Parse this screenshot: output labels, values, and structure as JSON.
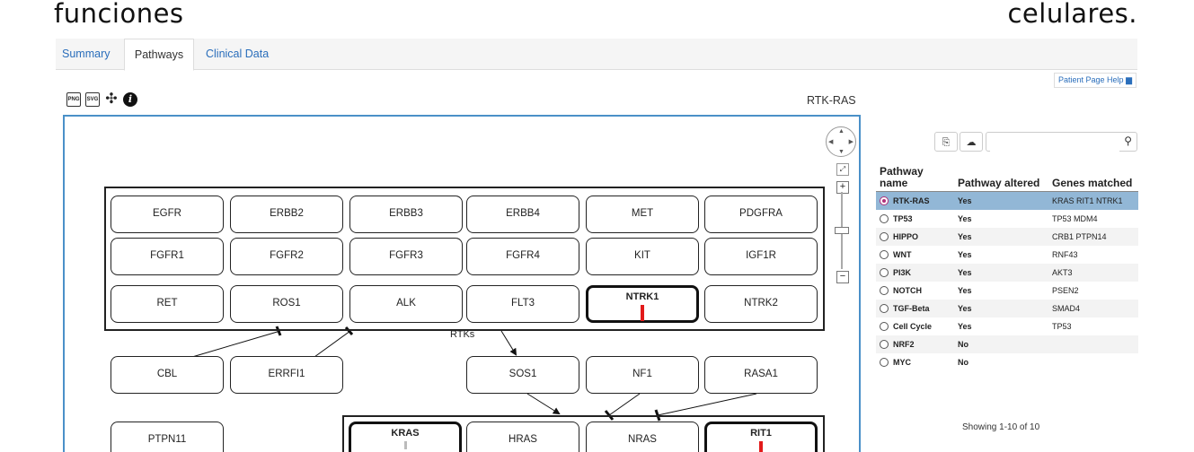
{
  "header_words": {
    "left": "funciones",
    "right": "celulares."
  },
  "tabs": [
    {
      "label": "Summary"
    },
    {
      "label": "Pathways"
    },
    {
      "label": "Clinical Data"
    }
  ],
  "help_link": "Patient Page Help",
  "toolbar_icons": {
    "png": "PNG",
    "svg": "SVG",
    "network": "network-icon",
    "info": "i"
  },
  "pathway_title": "RTK-RAS",
  "diagram": {
    "rtk_group_label": "RTKs",
    "rtk_rows": [
      [
        "EGFR",
        "ERBB2",
        "ERBB3",
        "ERBB4",
        "MET",
        "PDGFRA"
      ],
      [
        "FGFR1",
        "FGFR2",
        "FGFR3",
        "FGFR4",
        "KIT",
        "IGF1R"
      ],
      [
        "RET",
        "ROS1",
        "ALK",
        "FLT3",
        "NTRK1",
        "NTRK2"
      ]
    ],
    "regulators": [
      "CBL",
      "ERRFI1",
      "SOS1",
      "NF1",
      "RASA1"
    ],
    "bottom": [
      "PTPN11",
      "KRAS",
      "HRAS",
      "NRAS",
      "RIT1"
    ],
    "altered_genes": [
      "NTRK1",
      "KRAS",
      "RIT1"
    ],
    "alteration_color": "#e21a1a",
    "frame_color": "#4a90c8"
  },
  "zoom": {
    "fit": "⤢",
    "plus": "+",
    "minus": "−"
  },
  "table": {
    "search_placeholder": "",
    "columns": [
      "Pathway name",
      "Pathway altered",
      "Genes matched"
    ],
    "rows": [
      {
        "name": "RTK-RAS",
        "altered": "Yes",
        "genes": "KRAS RIT1 NTRK1",
        "selected": true
      },
      {
        "name": "TP53",
        "altered": "Yes",
        "genes": "TP53 MDM4"
      },
      {
        "name": "HIPPO",
        "altered": "Yes",
        "genes": "CRB1 PTPN14"
      },
      {
        "name": "WNT",
        "altered": "Yes",
        "genes": "RNF43"
      },
      {
        "name": "PI3K",
        "altered": "Yes",
        "genes": "AKT3"
      },
      {
        "name": "NOTCH",
        "altered": "Yes",
        "genes": "PSEN2"
      },
      {
        "name": "TGF-Beta",
        "altered": "Yes",
        "genes": "SMAD4"
      },
      {
        "name": "Cell Cycle",
        "altered": "Yes",
        "genes": "TP53"
      },
      {
        "name": "NRF2",
        "altered": "No",
        "genes": ""
      },
      {
        "name": "MYC",
        "altered": "No",
        "genes": ""
      }
    ],
    "showing": "Showing 1-10 of 10",
    "selected_color": "#92b7d6"
  }
}
